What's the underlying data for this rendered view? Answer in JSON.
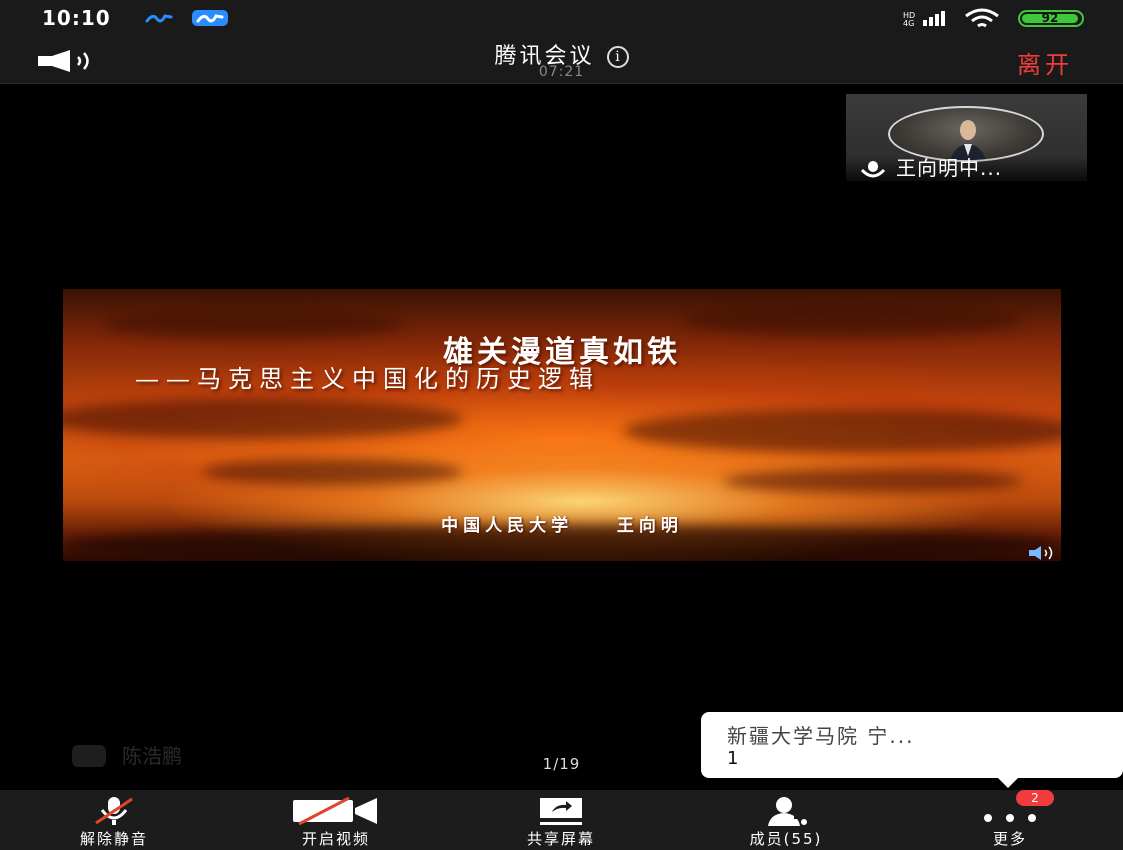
{
  "status_bar": {
    "time": "10:10",
    "battery": "92",
    "icons": [
      "messenger-app-icon",
      "messenger-app-icon-active",
      "signal-icon",
      "wifi-icon",
      "battery-icon"
    ]
  },
  "header": {
    "title": "腾讯会议",
    "timer": "07:21",
    "leave_label": "离开",
    "info_glyph": "i"
  },
  "thumbnail": {
    "participant_name": "王向明中..."
  },
  "slide": {
    "title": "雄关漫道真如铁",
    "subtitle": "——马克思主义中国化的历史逻辑",
    "author": "中国人民大学    王向明",
    "page": "1/19"
  },
  "overlay": {
    "faded_name": "陈浩鹏"
  },
  "notification": {
    "name": "新疆大学马院 宁...",
    "count": "1"
  },
  "toolbar": {
    "unmute_label": "解除静音",
    "video_label": "开启视频",
    "share_label": "共享屏幕",
    "members_label": "成员(55)",
    "more_label": "更多",
    "more_badge": "2"
  },
  "colors": {
    "leave": "#f03c3c",
    "battery": "#3ec83a",
    "badge": "#f03c3c",
    "mute_slash": "#e0442e"
  }
}
